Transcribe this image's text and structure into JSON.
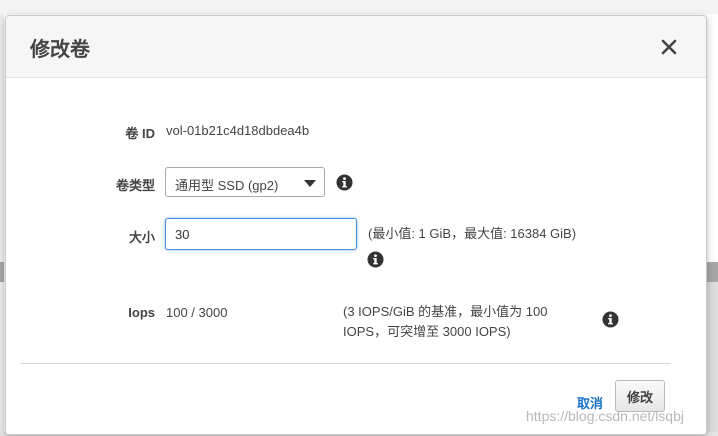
{
  "modal": {
    "title": "修改卷",
    "close_icon": "close-icon"
  },
  "fields": {
    "volume_id": {
      "label": "卷 ID",
      "value": "vol-01b21c4d18dbdea4b"
    },
    "volume_type": {
      "label": "卷类型",
      "selected": "通用型 SSD (gp2)",
      "info_icon": "info-icon"
    },
    "size": {
      "label": "大小",
      "value": "30",
      "hint": "(最小值: 1 GiB，最大值: 16384 GiB)",
      "info_icon": "info-icon"
    },
    "iops": {
      "label": "Iops",
      "value": "100 / 3000",
      "hint_line1": "(3 IOPS/GiB 的基准，最小值为 100",
      "hint_line2": "IOPS，可突增至 3000 IOPS)",
      "info_icon": "info-icon"
    }
  },
  "footer": {
    "cancel_label": "取消",
    "modify_label": "修改"
  },
  "watermark": "https://blog.csdn.net/lsqbj",
  "colors": {
    "header_bg": "#f6f6f6",
    "link": "#1a73c6",
    "focus_border": "#4a90d9",
    "text": "#444444"
  }
}
